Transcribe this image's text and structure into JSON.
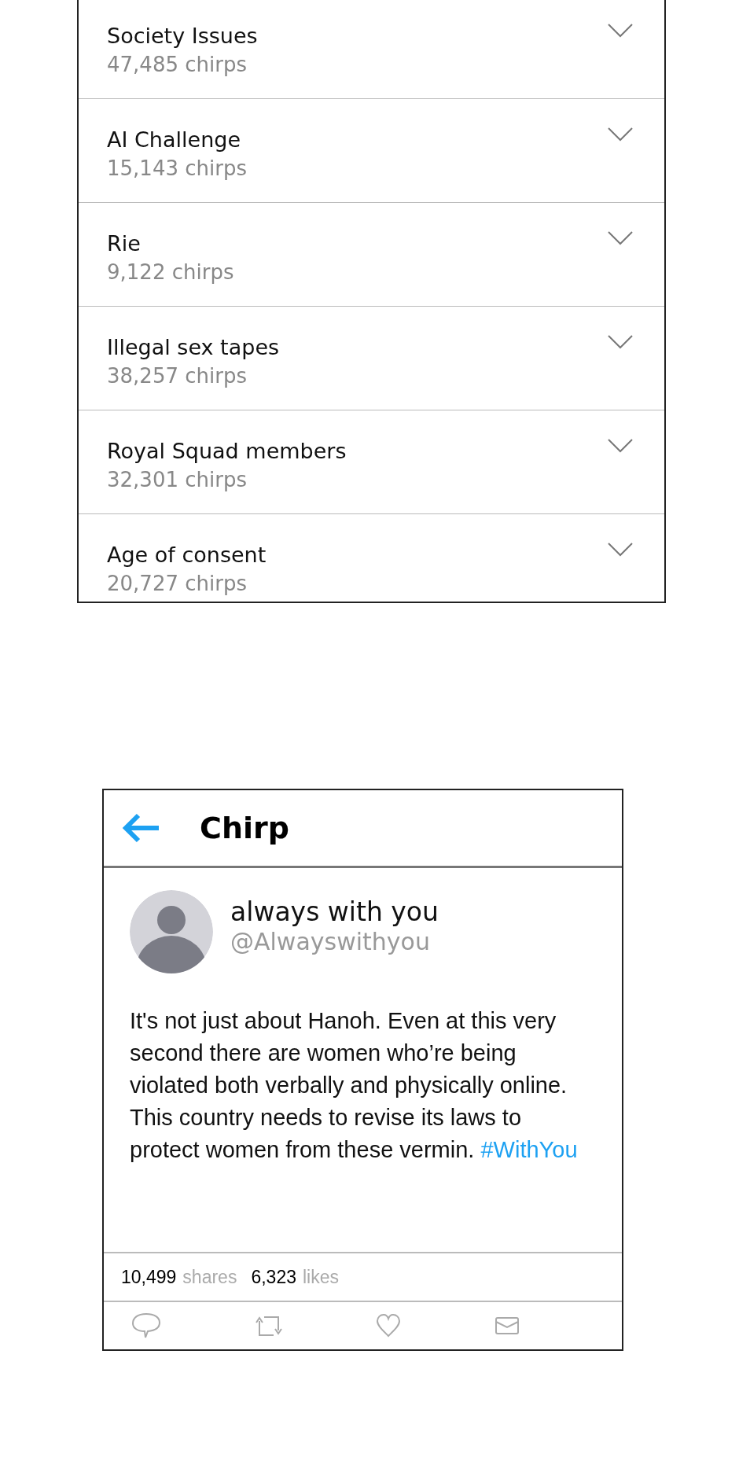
{
  "topics": [
    {
      "title": "Society Issues",
      "count": "47,485 chirps"
    },
    {
      "title": "AI Challenge",
      "count": "15,143 chirps"
    },
    {
      "title": "Rie",
      "count": "9,122 chirps"
    },
    {
      "title": "Illegal sex tapes",
      "count": "38,257 chirps"
    },
    {
      "title": "Royal Squad members",
      "count": "32,301 chirps"
    },
    {
      "title": "Age of consent",
      "count": "20,727 chirps"
    }
  ],
  "post": {
    "header": {
      "title": "Chirp"
    },
    "author": {
      "name": "always with you",
      "handle": "@Alwayswithyou"
    },
    "text": "It's not just about Hanoh. Even at this very second there are women who’re being violated both verbally and physically online. This country needs to revise its laws to protect women from these vermin.",
    "hashtag": "#WithYou",
    "stats": [
      {
        "count": "10,499",
        "label": "shares"
      },
      {
        "count": "6,323",
        "label": "likes"
      }
    ]
  }
}
